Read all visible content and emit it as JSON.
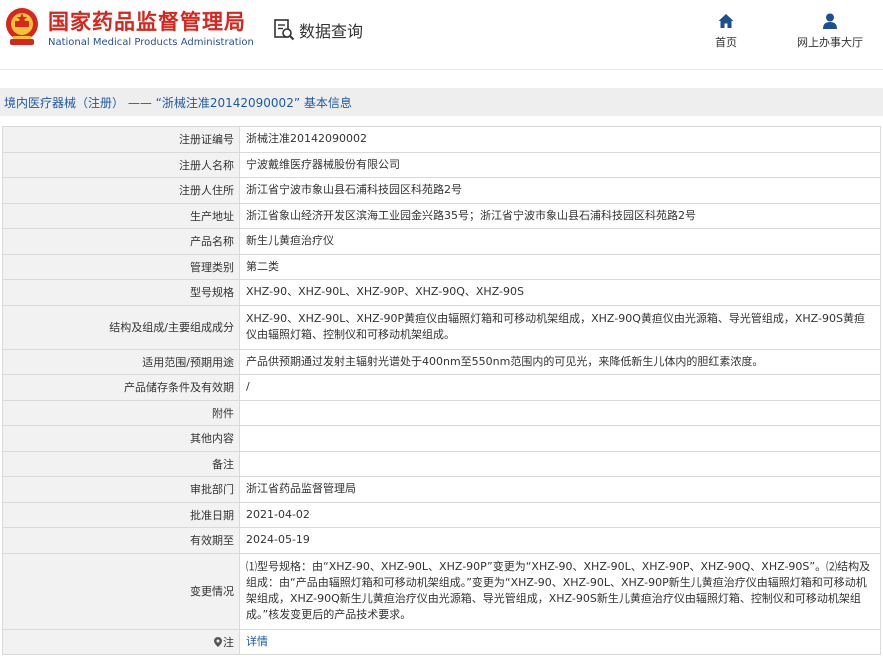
{
  "header": {
    "agency_cn": "国家药品监督管理局",
    "agency_en": "National Medical Products Administration",
    "db_title": "数据查询",
    "nav": [
      {
        "label": "首页",
        "icon": "home-icon"
      },
      {
        "label": "网上办事大厅",
        "icon": "user-icon"
      }
    ]
  },
  "breadcrumb": "境内医疗器械（注册） —— “浙械注准20142090002” 基本信息",
  "colors": {
    "brand_red": "#d6261e",
    "brand_blue": "#2a4f9e",
    "link": "#1d5aa3"
  },
  "rows": [
    {
      "label": "注册证编号",
      "value": "浙械注准20142090002"
    },
    {
      "label": "注册人名称",
      "value": "宁波戴维医疗器械股份有限公司"
    },
    {
      "label": "注册人住所",
      "value": "浙江省宁波市象山县石浦科技园区科苑路2号"
    },
    {
      "label": "生产地址",
      "value": "浙江省象山经济开发区滨海工业园金兴路35号；浙江省宁波市象山县石浦科技园区科苑路2号"
    },
    {
      "label": "产品名称",
      "value": "新生儿黄疸治疗仪"
    },
    {
      "label": "管理类别",
      "value": "第二类"
    },
    {
      "label": "型号规格",
      "value": "XHZ-90、XHZ-90L、XHZ-90P、XHZ-90Q、XHZ-90S"
    },
    {
      "label": "结构及组成/主要组成成分",
      "value": "XHZ-90、XHZ-90L、XHZ-90P黄疸仪由辐照灯箱和可移动机架组成，XHZ-90Q黄疸仪由光源箱、导光管组成，XHZ-90S黄疸仪由辐照灯箱、控制仪和可移动机架组成。"
    },
    {
      "label": "适用范围/预期用途",
      "value": "产品供预期通过发射主辐射光谱处于400nm至550nm范围内的可见光，来降低新生儿体内的胆红素浓度。"
    },
    {
      "label": "产品储存条件及有效期",
      "value": "/"
    },
    {
      "label": "附件",
      "value": ""
    },
    {
      "label": "其他内容",
      "value": ""
    },
    {
      "label": "备注",
      "value": ""
    },
    {
      "label": "审批部门",
      "value": "浙江省药品监督管理局"
    },
    {
      "label": "批准日期",
      "value": "2021-04-02"
    },
    {
      "label": "有效期至",
      "value": "2024-05-19"
    },
    {
      "label": "变更情况",
      "value": "⑴型号规格：由“XHZ-90、XHZ-90L、XHZ-90P”变更为“XHZ-90、XHZ-90L、XHZ-90P、XHZ-90Q、XHZ-90S”。⑵结构及组成：由“产品由辐照灯箱和可移动机架组成。”变更为“XHZ-90、XHZ-90L、XHZ-90P新生儿黄疸治疗仪由辐照灯箱和可移动机架组成，XHZ-90Q新生儿黄疸治疗仪由光源箱、导光管组成，XHZ-90S新生儿黄疸治疗仪由辐照灯箱、控制仪和可移动机架组成。”核发变更后的产品技术要求。"
    },
    {
      "label": "注",
      "value": "详情"
    }
  ]
}
